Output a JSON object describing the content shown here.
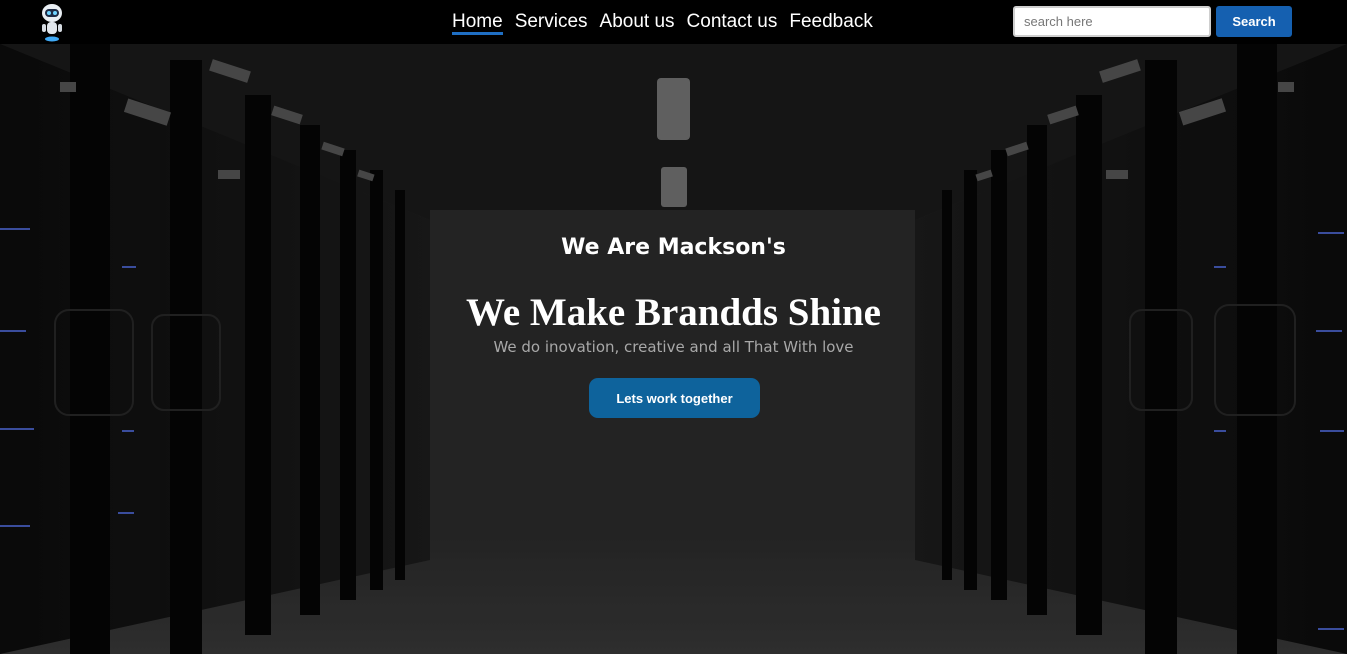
{
  "header": {
    "logo_icon": "robot-icon",
    "nav": [
      {
        "label": "Home",
        "active": true
      },
      {
        "label": "Services",
        "active": false
      },
      {
        "label": "About us",
        "active": false
      },
      {
        "label": "Contact us",
        "active": false
      },
      {
        "label": "Feedback",
        "active": false
      }
    ],
    "search": {
      "placeholder": "search here",
      "value": "",
      "button_label": "Search"
    }
  },
  "hero": {
    "kicker": "We Are Mackson's",
    "title": "We Make Brandds Shine",
    "subtitle": "We do inovation, creative and all That With love",
    "cta_label": "Lets work together"
  },
  "colors": {
    "navbar_bg": "#000000",
    "accent": "#1560b0",
    "cta_bg": "#0e639c",
    "active_underline": "#1f6fc4",
    "subtitle_text": "#a8a8a8"
  }
}
